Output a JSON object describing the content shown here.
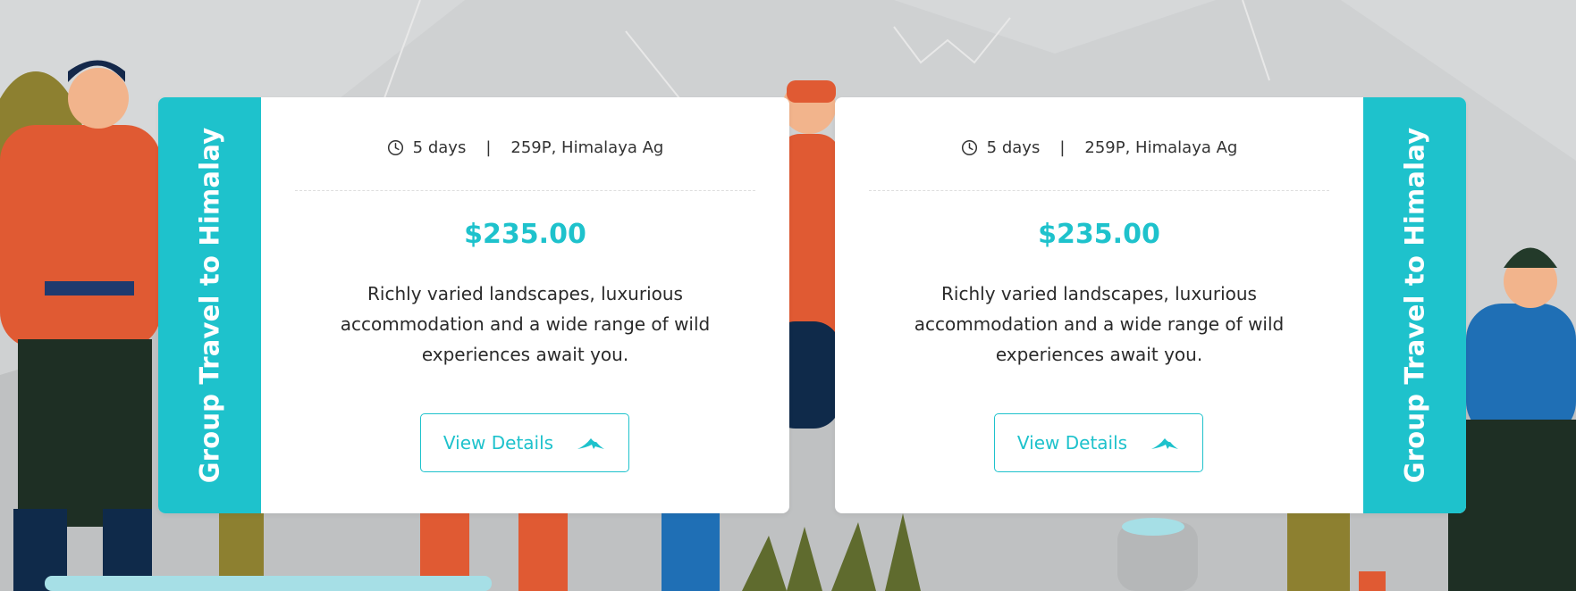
{
  "cards": [
    {
      "title": "Group Travel to Himalay",
      "duration": "5 days",
      "separator": "|",
      "location": "259P, Himalaya Ag",
      "price": "$235.00",
      "description": "Richly varied landscapes, luxurious accommodation and a wide range of wild experiences await you.",
      "button_label": "View Details",
      "strip_side": "left"
    },
    {
      "title": "Group Travel to Himalay",
      "duration": "5 days",
      "separator": "|",
      "location": "259P, Himalaya Ag",
      "price": "$235.00",
      "description": "Richly varied landscapes, luxurious accommodation and a wide range of wild experiences await you.",
      "button_label": "View Details",
      "strip_side": "right"
    }
  ],
  "colors": {
    "accent": "#1ec2cc",
    "background": "#d6d8d9",
    "text": "#2a2a2a"
  },
  "icons": {
    "duration": "clock-icon",
    "button": "mountain-icon"
  }
}
